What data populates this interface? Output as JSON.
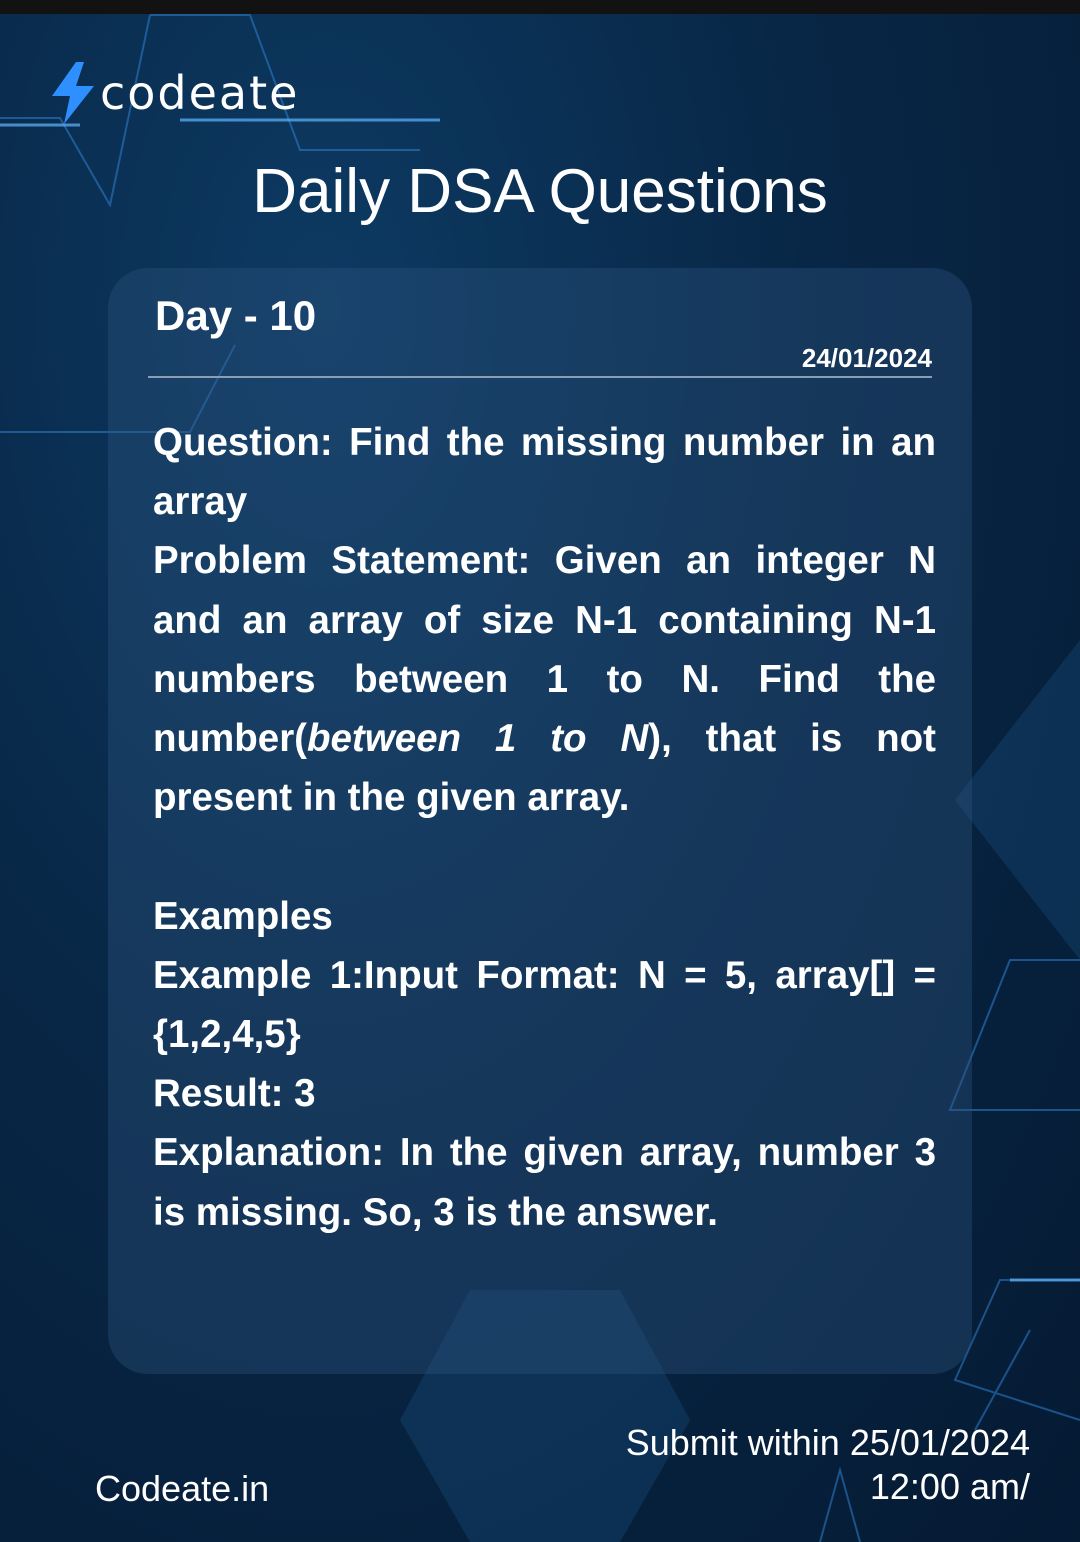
{
  "brand": {
    "name": "codeate",
    "icon": "lightning-bolt-icon",
    "accent": "#2e90ff"
  },
  "header": {
    "title": "Daily DSA Questions"
  },
  "card": {
    "day": "Day - 10",
    "date": "24/01/2024",
    "question_prefix": "Question: ",
    "question": "Find the missing number in an array",
    "statement_prefix": "Problem Statement: Given an integer N and an array of size N-1 containing N-1 numbers between 1 to N. Find the number(",
    "statement_italic": "between 1 to N",
    "statement_suffix": "), that is not present in the given array.",
    "examples_heading": "Examples",
    "example1": "Example 1:Input Format: N = 5, array[] = {1,2,4,5}",
    "result": "Result: 3",
    "explanation": "Explanation: In the given array, number 3 is missing. So, 3 is the answer."
  },
  "footer": {
    "site": "Codeate.in",
    "deadline_line1": "Submit within 25/01/2024",
    "deadline_line2": "12:00 am/"
  }
}
